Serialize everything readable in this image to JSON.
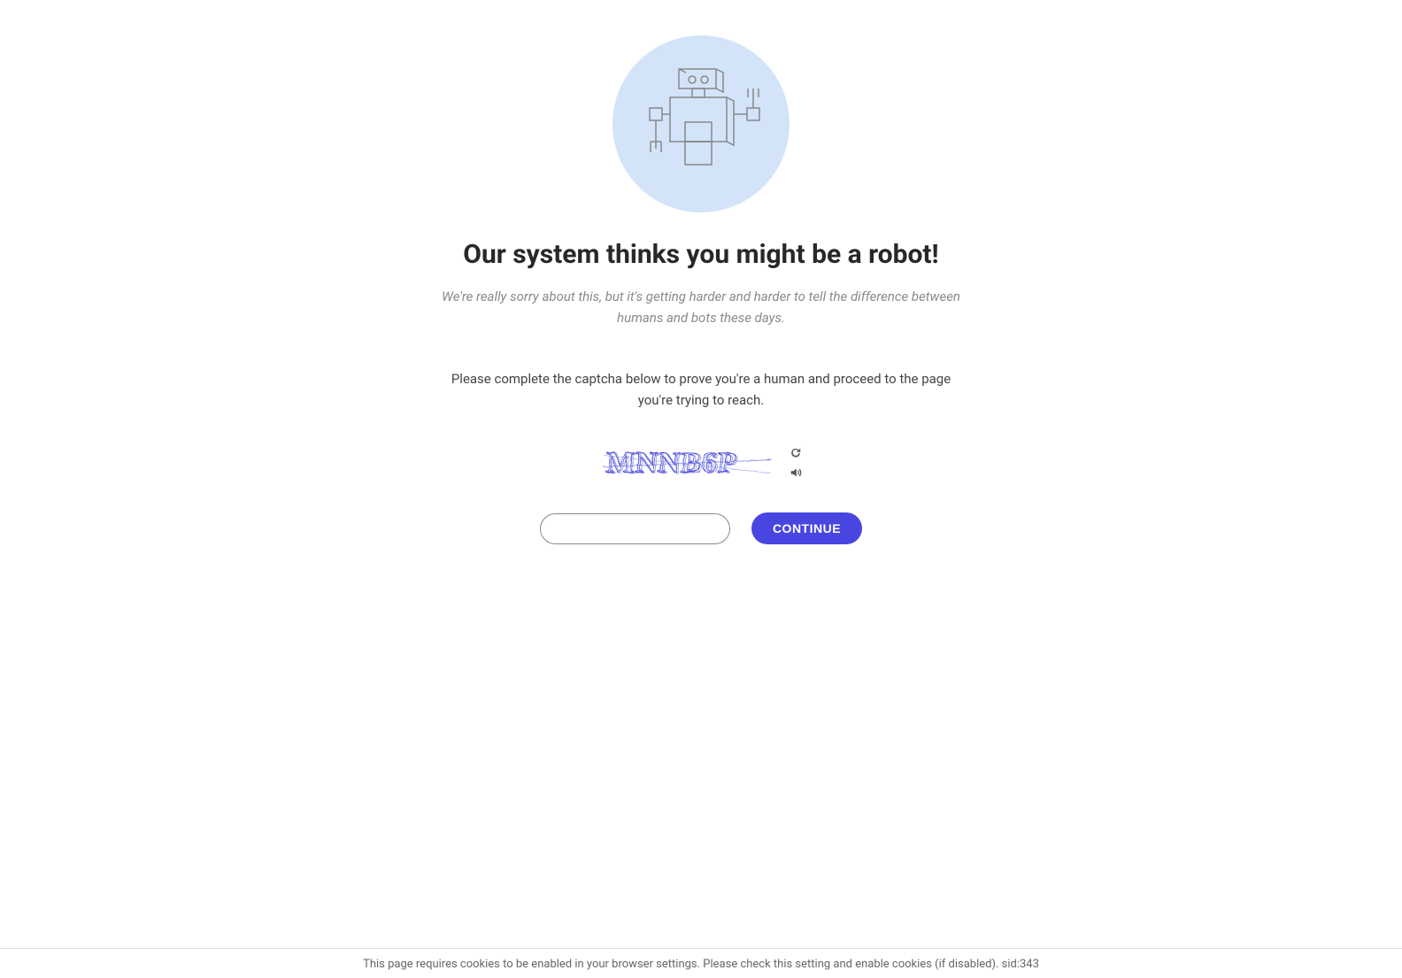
{
  "heading": "Our system thinks you might be a robot!",
  "subheading": "We're really sorry about this, but it's getting harder and harder to tell the difference between humans and bots these days.",
  "instruction": "Please complete the captcha below to prove you're a human and proceed to the page you're trying to reach.",
  "captcha_text": "MNNB6P",
  "continue_label": "CONTINUE",
  "footer_text": "This page requires cookies to be enabled in your browser settings. Please check this setting and enable cookies (if disabled). sid:343"
}
